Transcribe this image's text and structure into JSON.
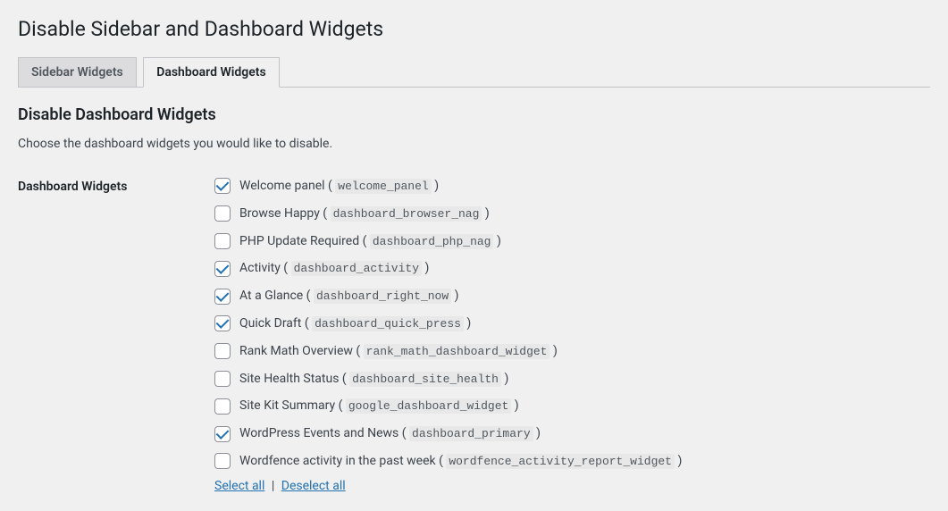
{
  "page_title": "Disable Sidebar and Dashboard Widgets",
  "tabs": [
    {
      "label": "Sidebar Widgets",
      "active": false
    },
    {
      "label": "Dashboard Widgets",
      "active": true
    }
  ],
  "section_title": "Disable Dashboard Widgets",
  "section_desc": "Choose the dashboard widgets you would like to disable.",
  "field_label": "Dashboard Widgets",
  "widgets": [
    {
      "label": "Welcome panel",
      "code": "welcome_panel",
      "checked": true
    },
    {
      "label": "Browse Happy",
      "code": "dashboard_browser_nag",
      "checked": false
    },
    {
      "label": "PHP Update Required",
      "code": "dashboard_php_nag",
      "checked": false
    },
    {
      "label": "Activity",
      "code": "dashboard_activity",
      "checked": true
    },
    {
      "label": "At a Glance",
      "code": "dashboard_right_now",
      "checked": true
    },
    {
      "label": "Quick Draft",
      "code": "dashboard_quick_press",
      "checked": true
    },
    {
      "label": "Rank Math Overview",
      "code": "rank_math_dashboard_widget",
      "checked": false
    },
    {
      "label": "Site Health Status",
      "code": "dashboard_site_health",
      "checked": false
    },
    {
      "label": "Site Kit Summary",
      "code": "google_dashboard_widget",
      "checked": false
    },
    {
      "label": "WordPress Events and News",
      "code": "dashboard_primary",
      "checked": true
    },
    {
      "label": "Wordfence activity in the past week",
      "code": "wordfence_activity_report_widget",
      "checked": false
    }
  ],
  "select_all_label": "Select all",
  "deselect_all_label": "Deselect all",
  "separator": " | "
}
